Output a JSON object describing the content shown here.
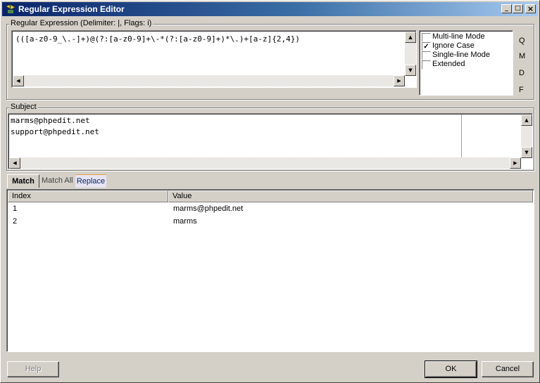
{
  "window": {
    "title": "Regular Expression Editor",
    "minimize_glyph": "_",
    "maximize_glyph": "□",
    "close_glyph": "×"
  },
  "regex_group": {
    "label": "Regular Expression (Delimiter: |, Flags: i)",
    "expression": "(([a-z0-9_\\.-]+)@(?:[a-z0-9]+\\-*(?:[a-z0-9]+)*\\.)+[a-z]{2,4})"
  },
  "options": [
    {
      "label": "Multi-line Mode",
      "checked": false
    },
    {
      "label": "Ignore Case",
      "checked": true
    },
    {
      "label": "Single-line Mode",
      "checked": false
    },
    {
      "label": "Extended",
      "checked": false
    }
  ],
  "side_letters": [
    "Q",
    "M",
    "D",
    "F"
  ],
  "subject_group": {
    "label": "Subject",
    "lines": [
      "marms@phpedit.net",
      "support@phpedit.net"
    ]
  },
  "tabs": [
    {
      "label": "Match",
      "active": true
    },
    {
      "label": "Match All",
      "active": false
    },
    {
      "label": "Replace",
      "active": false
    }
  ],
  "results": {
    "columns": [
      "Index",
      "Value"
    ],
    "rows": [
      {
        "index": "1",
        "value": "marms@phpedit.net"
      },
      {
        "index": "2",
        "value": "marms"
      }
    ]
  },
  "buttons": {
    "help": "Help",
    "ok": "OK",
    "cancel": "Cancel"
  },
  "colors": {
    "titlebar_start": "#0a246a",
    "titlebar_end": "#a6caf0",
    "face": "#d4d0c8"
  }
}
